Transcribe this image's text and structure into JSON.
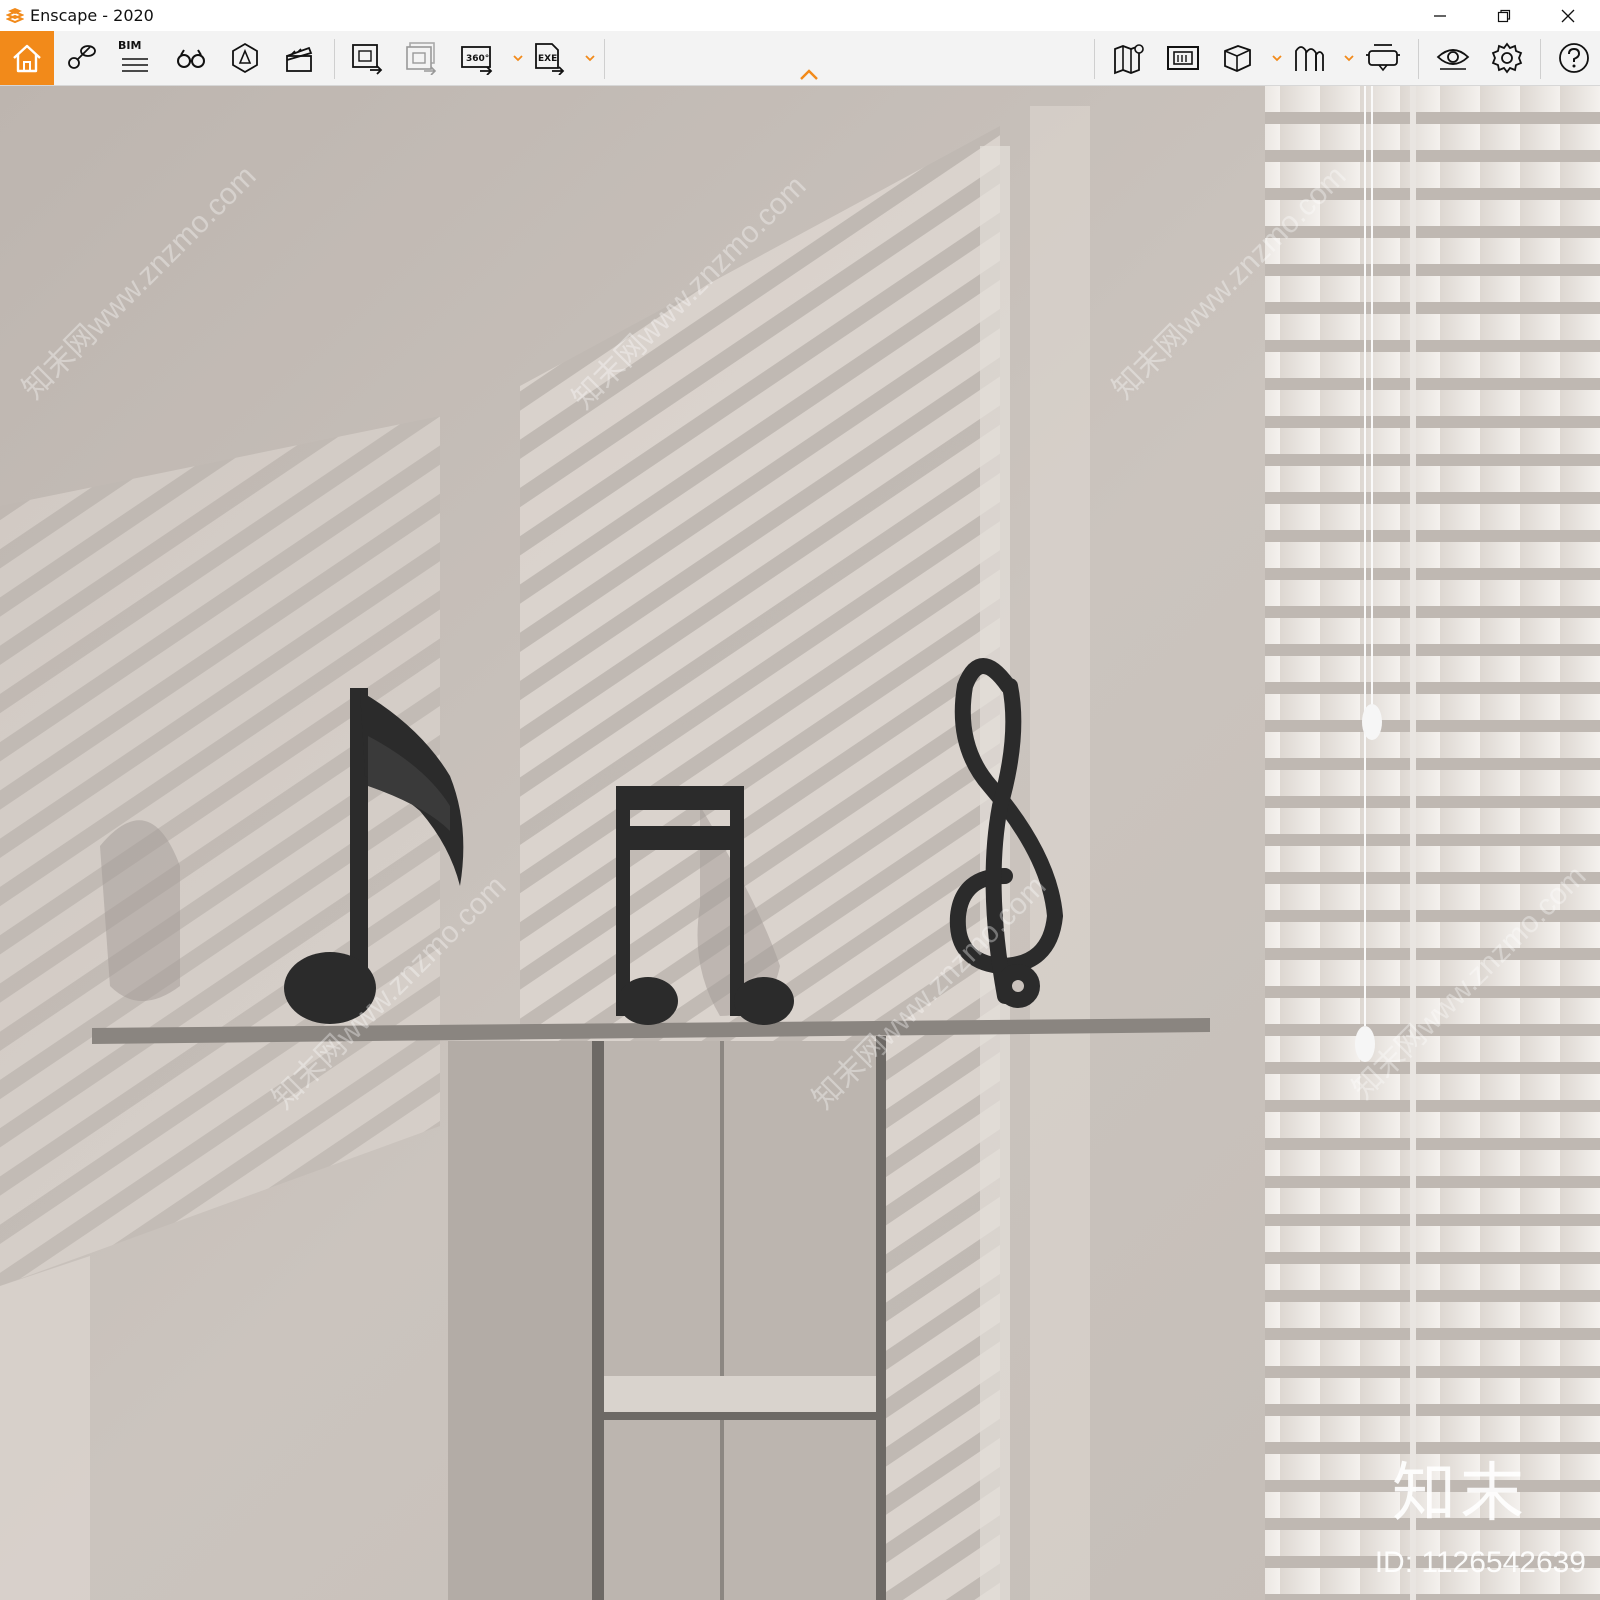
{
  "window": {
    "title": "Enscape - 2020",
    "accent_color": "#f28a1a"
  },
  "toolbar": {
    "bim_label": "BIM",
    "buttons": [
      {
        "name": "home-button",
        "icon": "home-icon"
      },
      {
        "name": "views-button",
        "icon": "pin-icon"
      },
      {
        "name": "bim-info-button",
        "icon": "bim-list-icon"
      },
      {
        "name": "walk-mode-button",
        "icon": "binoculars-icon"
      },
      {
        "name": "asset-library-button",
        "icon": "asset-icon"
      },
      {
        "name": "video-editor-button",
        "icon": "clapperboard-icon"
      },
      {
        "name": "render-image-button",
        "icon": "render-image-icon"
      },
      {
        "name": "batch-render-button",
        "icon": "batch-render-icon"
      },
      {
        "name": "panorama-button",
        "icon": "panorama-360-icon"
      },
      {
        "name": "export-exe-button",
        "icon": "export-exe-icon"
      },
      {
        "name": "map-button",
        "icon": "map-icon"
      },
      {
        "name": "upload-button",
        "icon": "upload-icon"
      },
      {
        "name": "view-box-button",
        "icon": "cube-icon"
      },
      {
        "name": "material-editor-button",
        "icon": "material-icon"
      },
      {
        "name": "vr-button",
        "icon": "vr-headset-icon"
      },
      {
        "name": "visual-settings-button",
        "icon": "eye-icon"
      },
      {
        "name": "settings-button",
        "icon": "gear-icon"
      },
      {
        "name": "help-button",
        "icon": "help-icon"
      }
    ]
  },
  "watermark": {
    "logo_text": "知末",
    "id_text": "ID: 1126542639",
    "repeat_text": "知末网www.znzmo.com"
  }
}
